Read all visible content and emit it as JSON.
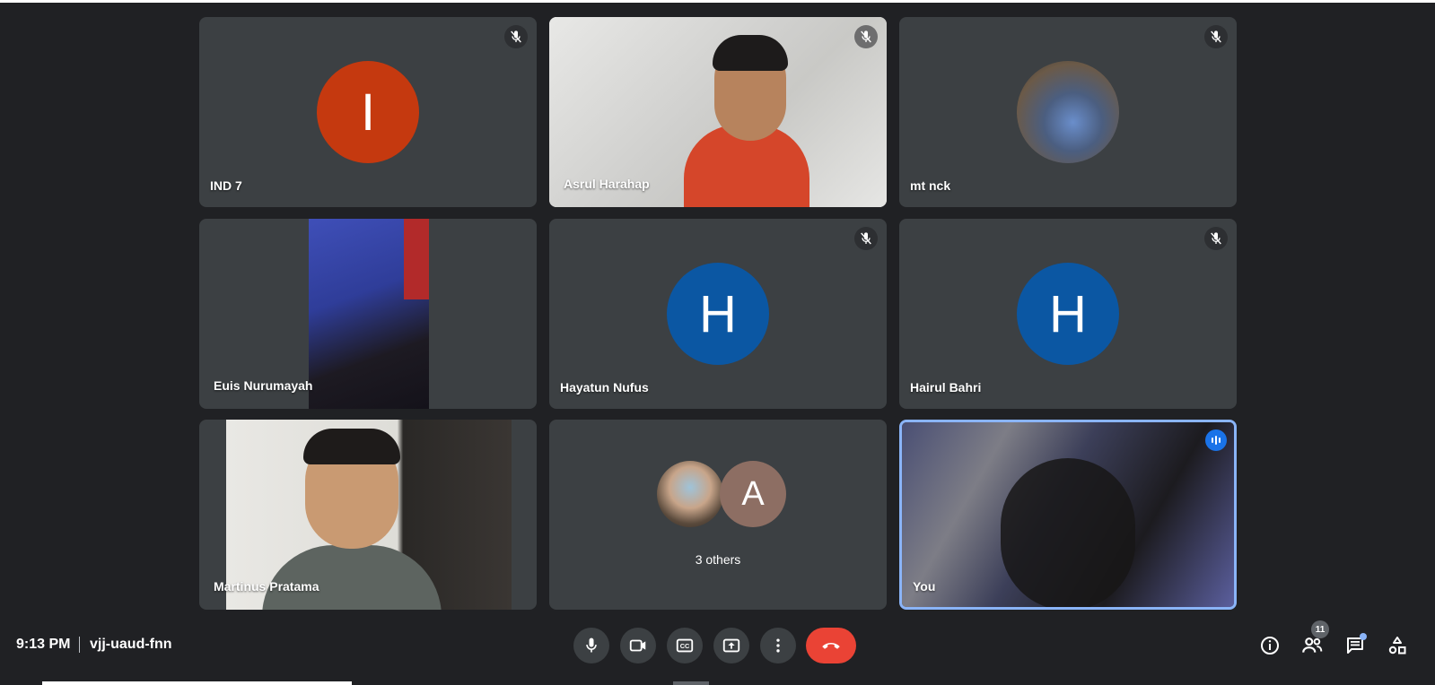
{
  "tiles": [
    {
      "name": "IND 7",
      "initial": "I",
      "avatar_color": "#c5390f",
      "muted": true
    },
    {
      "name": "Asrul Harahap",
      "muted": true
    },
    {
      "name": "mt nck",
      "muted": true
    },
    {
      "name": "Euis Nurumayah",
      "muted": false
    },
    {
      "name": "Hayatun Nufus",
      "initial": "H",
      "avatar_color": "#0b57a3",
      "muted": true
    },
    {
      "name": "Hairul Bahri",
      "initial": "H",
      "avatar_color": "#0b57a3",
      "muted": true
    },
    {
      "name": "Martinus Pratama",
      "muted": false
    },
    {
      "name": "3 others",
      "initial": "A",
      "avatar_color": "#8d6e63"
    },
    {
      "name": "You",
      "speaking": true,
      "highlight_color": "#8ab4f8"
    }
  ],
  "bottom": {
    "time": "9:13 PM",
    "meeting_code": "vjj-uaud-fnn",
    "participant_count": "11",
    "controls": [
      "mic-icon",
      "camera-icon",
      "captions-icon",
      "present-icon",
      "more-icon",
      "hangup-icon"
    ],
    "right_icons": [
      "info-icon",
      "people-icon",
      "chat-icon",
      "activities-icon"
    ]
  }
}
